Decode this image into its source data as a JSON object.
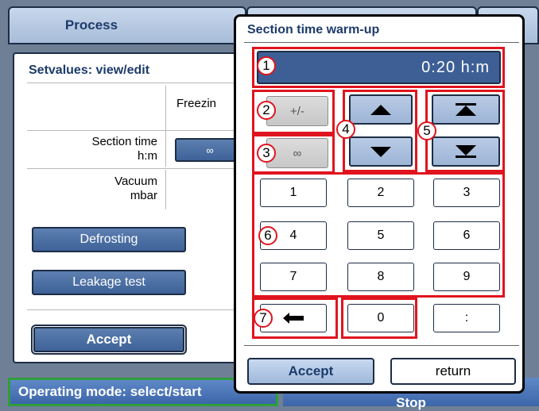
{
  "main": {
    "tab_process": "Process",
    "setvalues_title": "Setvalues: view/edit",
    "col_freezing": "Freezin",
    "row_section_time_line1": "Section time",
    "row_section_time_line2": "h:m",
    "section_time_value": "∞",
    "row_vacuum_line1": "Vacuum",
    "row_vacuum_line2": "mbar",
    "defrosting_label": "Defrosting",
    "leakage_label": "Leakage test",
    "accept_label": "Accept",
    "operating_mode_label": "Operating mode: select/start",
    "stop_label": "Stop"
  },
  "dialog": {
    "title": "Section time warm-up",
    "display_value": "0:20 h:m",
    "plusminus_label": "+/-",
    "infinity_label": "∞",
    "keys": [
      "1",
      "2",
      "3",
      "4",
      "5",
      "6",
      "7",
      "8",
      "9",
      "0",
      ":"
    ],
    "accept_label": "Accept",
    "return_label": "return",
    "badges": [
      "1",
      "2",
      "3",
      "4",
      "5",
      "6",
      "7"
    ]
  },
  "colors": {
    "annotation_red": "#e0141e",
    "dark_blue": "#1d2d45",
    "button_blue": "#3e6298",
    "bottom_green": "#2e9f3a"
  },
  "icons": {
    "up": "triangle-up-icon",
    "down": "triangle-down-icon",
    "to_top": "jump-to-max-icon",
    "to_bottom": "jump-to-min-icon",
    "backspace": "backspace-arrow-icon"
  }
}
